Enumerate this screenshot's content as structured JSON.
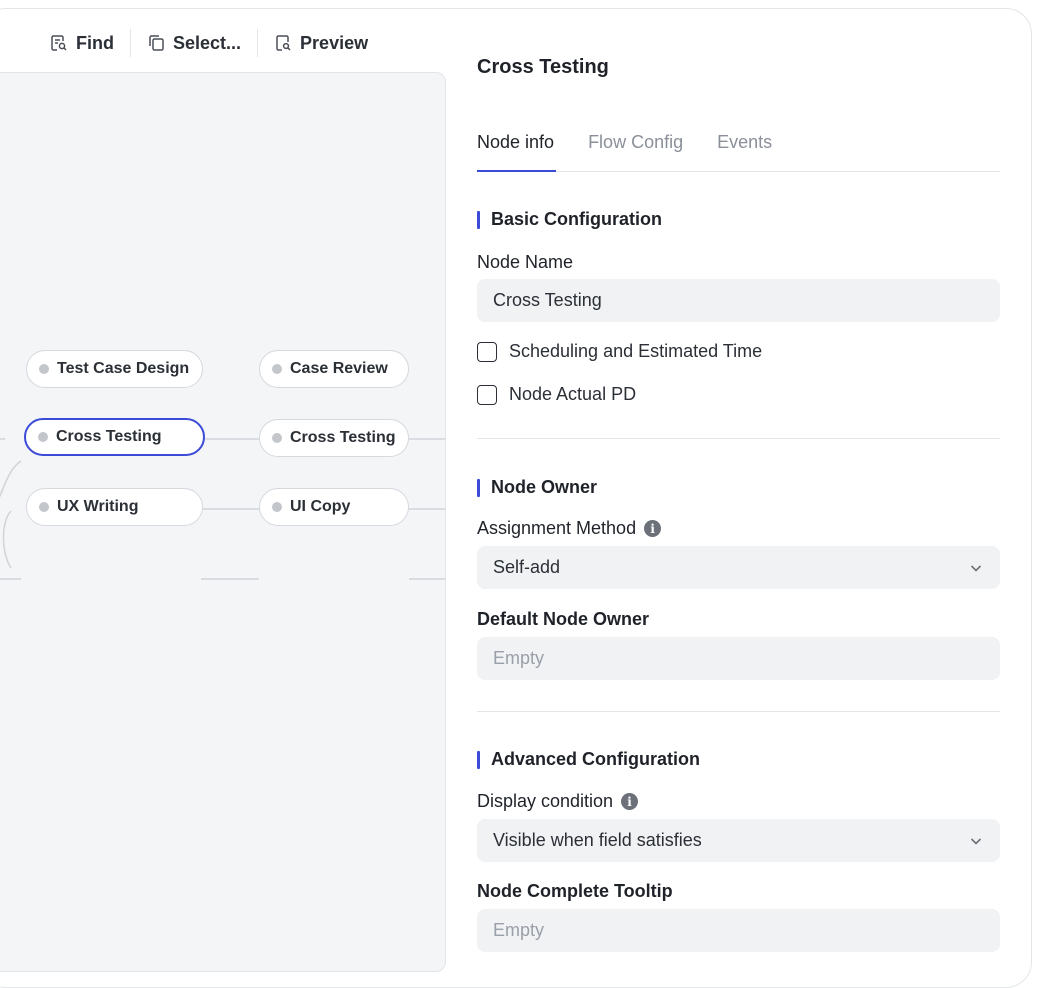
{
  "toolbar": {
    "find_label": "Find",
    "select_label": "Select...",
    "preview_label": "Preview"
  },
  "canvas": {
    "nodes": [
      {
        "label": "Test Case Design"
      },
      {
        "label": "Case Review"
      },
      {
        "label": "Cross Testing"
      },
      {
        "label": "Cross Testing"
      },
      {
        "label": "UX Writing"
      },
      {
        "label": "UI Copy"
      }
    ],
    "selected_node": "Cross Testing"
  },
  "panel": {
    "title": "Cross Testing",
    "tabs": [
      {
        "label": "Node info"
      },
      {
        "label": "Flow Config"
      },
      {
        "label": "Events"
      }
    ],
    "basic": {
      "title": "Basic Configuration",
      "node_name_label": "Node Name",
      "node_name_value": "Cross Testing",
      "checkboxes": [
        {
          "label": "Scheduling and Estimated Time"
        },
        {
          "label": "Node Actual PD"
        }
      ]
    },
    "owner": {
      "title": "Node Owner",
      "assignment_label": "Assignment Method",
      "assignment_value": "Self-add",
      "default_owner_label": "Default Node Owner",
      "default_owner_placeholder": "Empty"
    },
    "advanced": {
      "title": "Advanced Configuration",
      "display_condition_label": "Display condition",
      "display_condition_value": "Visible when field satisfies",
      "tooltip_label": "Node Complete Tooltip",
      "tooltip_placeholder": "Empty"
    }
  },
  "colors": {
    "accent": "#3b4bd8",
    "canvas_bg": "#f4f5f7",
    "input_bg": "#f1f2f4"
  }
}
